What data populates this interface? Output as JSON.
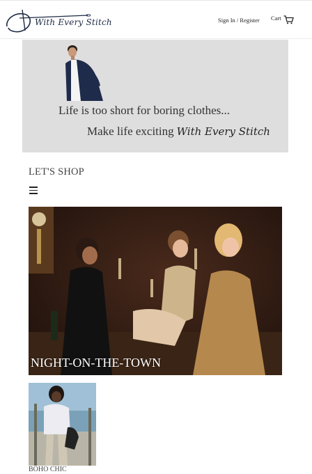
{
  "header": {
    "logo_text": "With Every Stitch",
    "signin_label": "Sign In / Register",
    "cart_label": "Cart"
  },
  "hero": {
    "line1": "Life is too short for boring clothes...",
    "line2": "Make life exciting",
    "brand": "With Every Stitch"
  },
  "shop": {
    "title": "LET'S SHOP",
    "featured": {
      "label": "NIGHT-ON-THE-TOWN"
    },
    "items": [
      {
        "label": "BOHO CHIC"
      }
    ]
  },
  "icons": [
    "needle-thread-logo-icon",
    "cart-icon",
    "menu-icon"
  ]
}
